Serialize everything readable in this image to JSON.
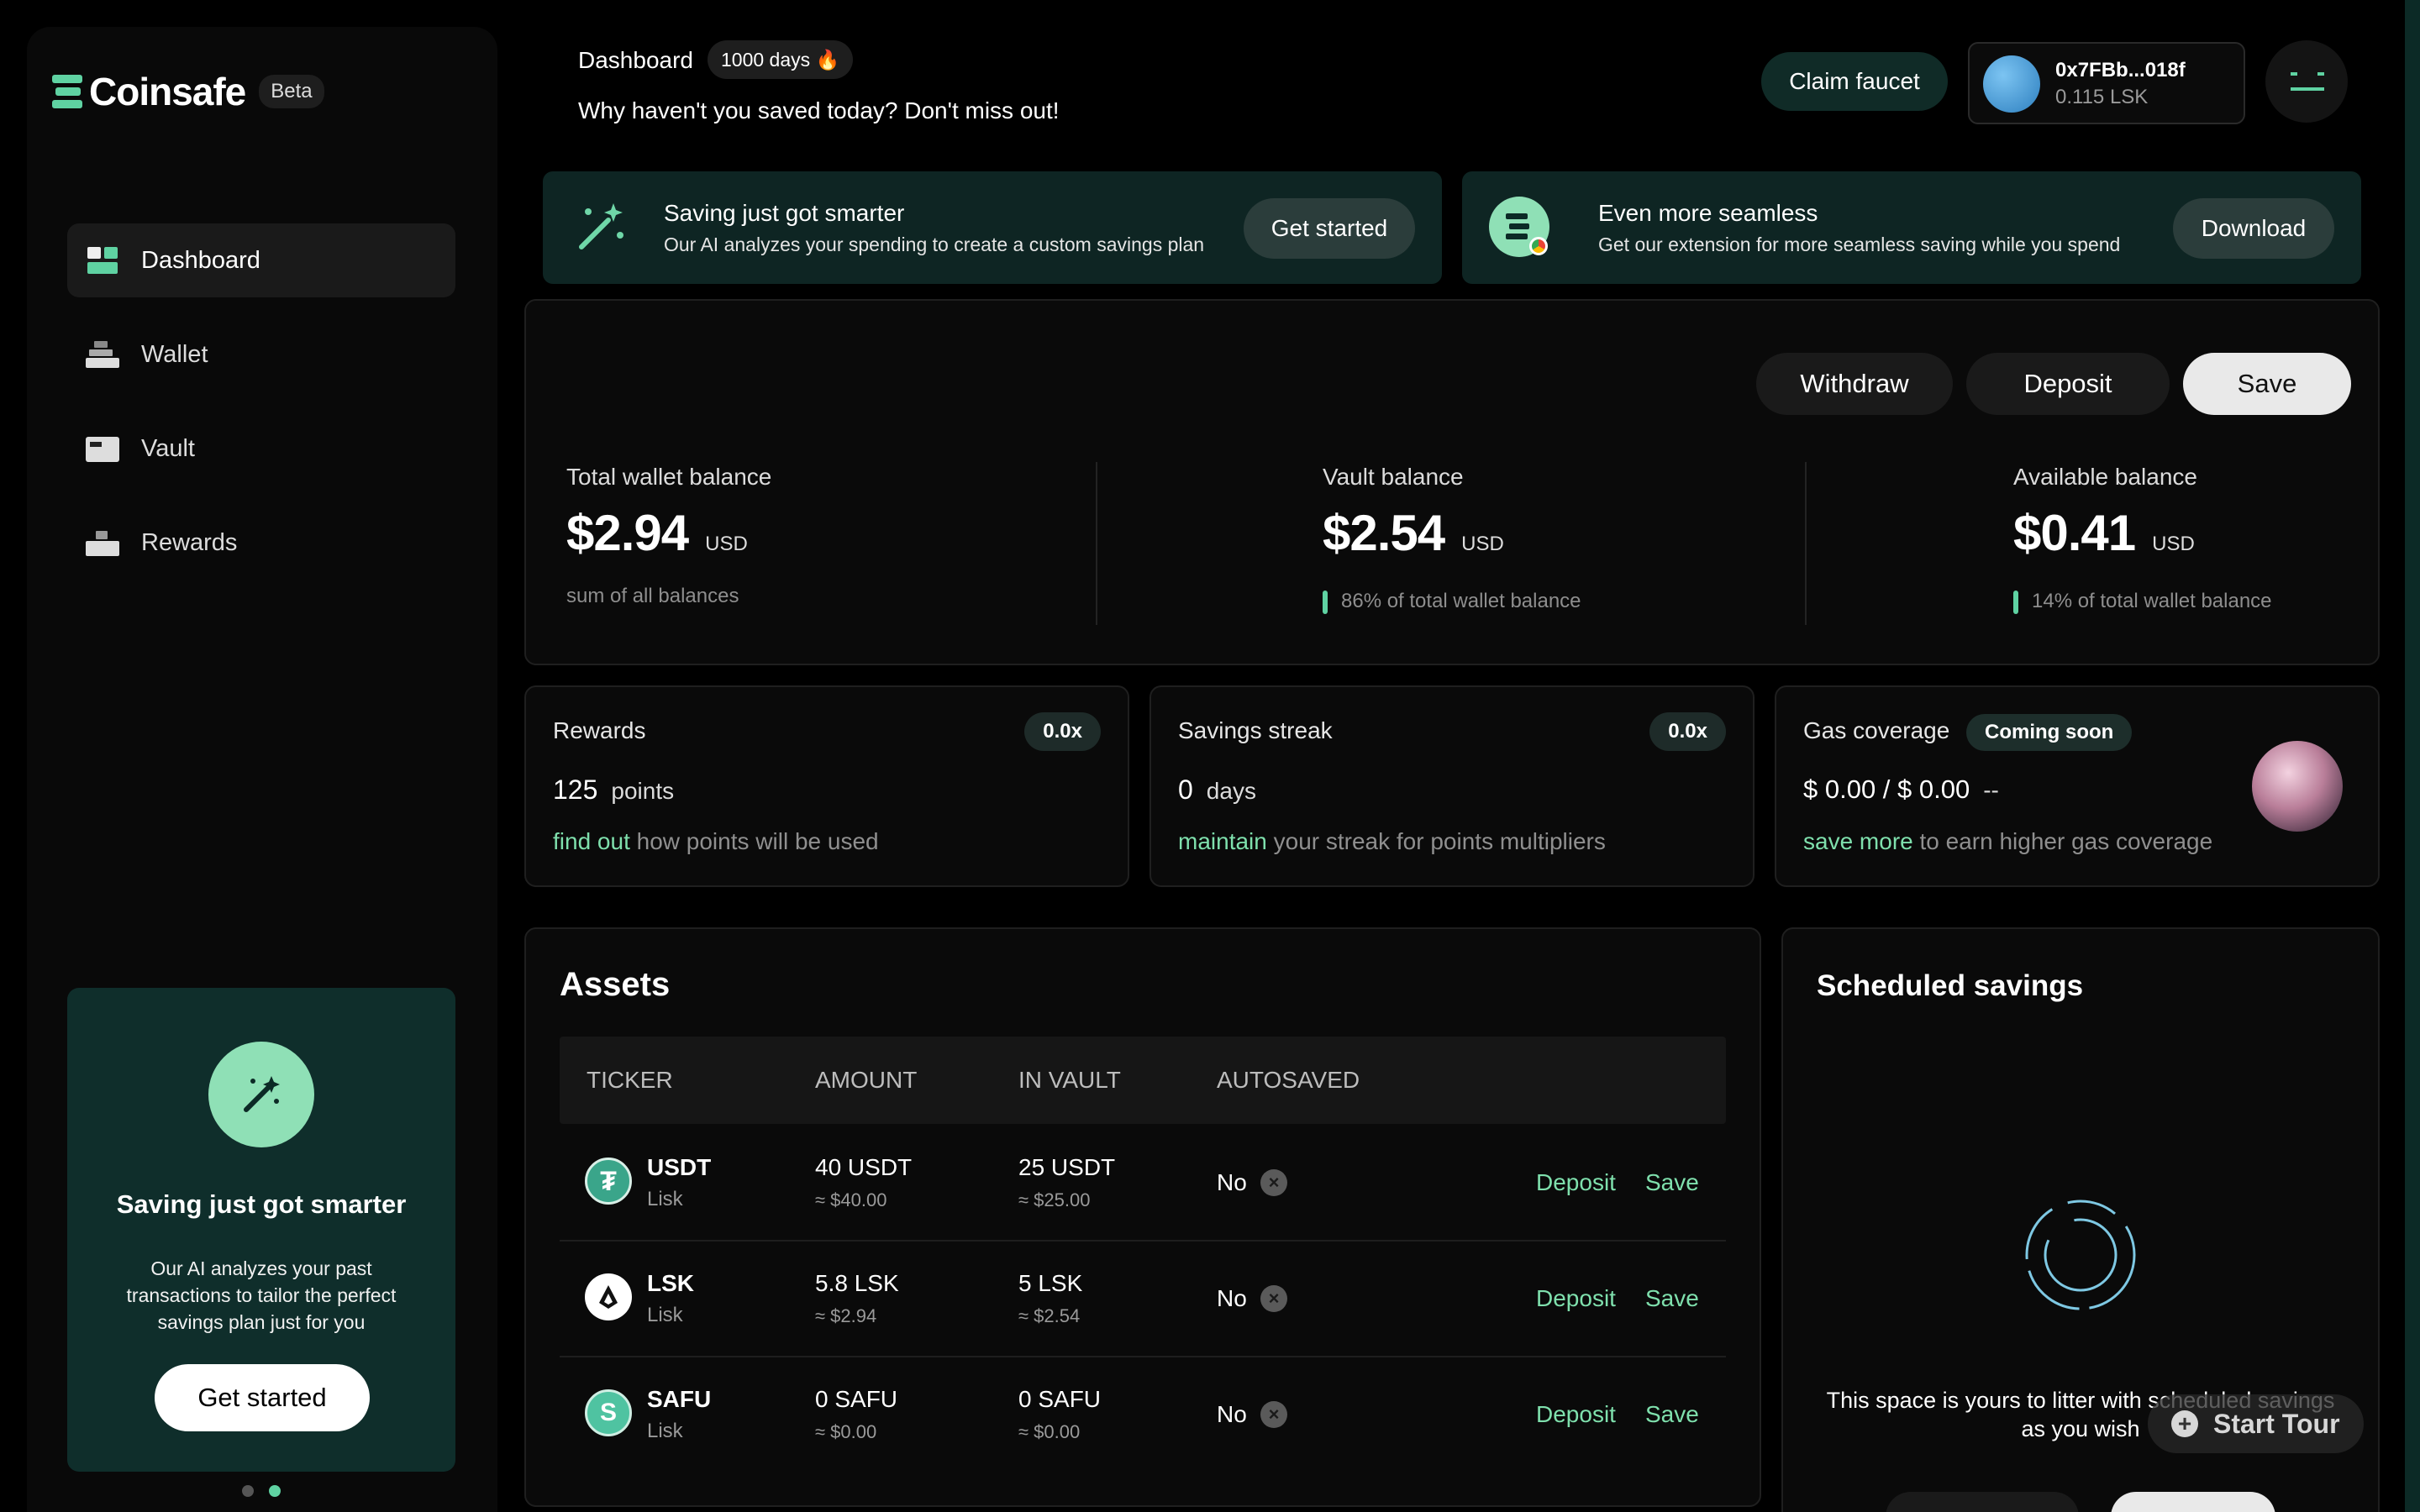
{
  "brand": {
    "name": "Coinsafe",
    "badge": "Beta"
  },
  "sidebar": {
    "items": [
      {
        "label": "Dashboard",
        "icon": "dashboard-icon",
        "active": true
      },
      {
        "label": "Wallet",
        "icon": "wallet-icon"
      },
      {
        "label": "Vault",
        "icon": "vault-icon"
      },
      {
        "label": "Rewards",
        "icon": "rewards-icon"
      }
    ],
    "promo": {
      "title": "Saving just got smarter",
      "text": "Our AI analyzes your past transactions to tailor the perfect savings plan just for you",
      "button": "Get started",
      "carousel_active": 2,
      "carousel_total": 2
    }
  },
  "header": {
    "title": "Dashboard",
    "streak_badge": "1000 days 🔥",
    "subtitle": "Why haven't you saved today? Don't miss out!",
    "claim_button": "Claim faucet",
    "wallet_address": "0x7FBb...018f",
    "wallet_balance": "0.115 LSK"
  },
  "banners": [
    {
      "title": "Saving just got smarter",
      "text": "Our AI analyzes your spending to create a custom savings plan",
      "button": "Get started"
    },
    {
      "title": "Even more seamless",
      "text": "Get our extension for more seamless saving while you spend",
      "button": "Download"
    }
  ],
  "actions": {
    "withdraw": "Withdraw",
    "deposit": "Deposit",
    "save": "Save"
  },
  "balances": {
    "total": {
      "label": "Total wallet balance",
      "value": "$2.94",
      "unit": "USD",
      "note": "sum of all balances"
    },
    "vault": {
      "label": "Vault balance",
      "value": "$2.54",
      "unit": "USD",
      "note": "86% of total wallet balance"
    },
    "available": {
      "label": "Available balance",
      "value": "$0.41",
      "unit": "USD",
      "note": "14% of total wallet balance"
    }
  },
  "stats": {
    "rewards": {
      "label": "Rewards",
      "multiplier": "0.0x",
      "value": "125",
      "unit": "points",
      "link": "find out",
      "text": "how points will be used"
    },
    "streak": {
      "label": "Savings streak",
      "multiplier": "0.0x",
      "value": "0",
      "unit": "days",
      "link": "maintain",
      "text": "your streak for points multipliers"
    },
    "gas": {
      "label": "Gas coverage",
      "badge": "Coming soon",
      "value": "$ 0.00 / $ 0.00",
      "suffix": "--",
      "link": "save more",
      "text": "to earn higher gas coverage"
    }
  },
  "assets": {
    "title": "Assets",
    "columns": [
      "TICKER",
      "AMOUNT",
      "IN VAULT",
      "AUTOSAVED"
    ],
    "rows": [
      {
        "ticker": "USDT",
        "chain": "Lisk",
        "amount": "40 USDT",
        "amount_usd": "≈ $40.00",
        "vault": "25 USDT",
        "vault_usd": "≈ $25.00",
        "autosaved": "No",
        "deposit": "Deposit",
        "save": "Save",
        "icon_color": "#3aa58a"
      },
      {
        "ticker": "LSK",
        "chain": "Lisk",
        "amount": "5.8 LSK",
        "amount_usd": "≈ $2.94",
        "vault": "5 LSK",
        "vault_usd": "≈ $2.54",
        "autosaved": "No",
        "deposit": "Deposit",
        "save": "Save",
        "icon_color": "#ffffff"
      },
      {
        "ticker": "SAFU",
        "chain": "Lisk",
        "amount": "0 SAFU",
        "amount_usd": "≈ $0.00",
        "vault": "0 SAFU",
        "vault_usd": "≈ $0.00",
        "autosaved": "No",
        "deposit": "Deposit",
        "save": "Save",
        "icon_color": "#4fc3a1"
      }
    ]
  },
  "scheduled": {
    "title": "Scheduled savings",
    "empty_text": "This space is yours to litter with scheduled savings as you wish",
    "tour_button": "Start Tour"
  },
  "colors": {
    "accent": "#7fe0ad",
    "banner_bg": "#0e2523",
    "promo_bg": "#0f2e2b"
  }
}
